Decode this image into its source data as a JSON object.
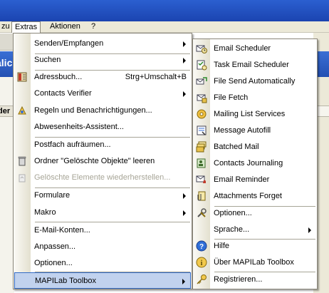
{
  "menubar": {
    "items": [
      {
        "label": "zu",
        "active": false
      },
      {
        "label": "Extras",
        "active": true
      },
      {
        "label": "Aktionen",
        "active": false
      },
      {
        "label": "?",
        "active": false
      }
    ]
  },
  "background": {
    "banner_text": "alic",
    "row_label": "der"
  },
  "extras_menu": {
    "items": [
      {
        "label": "Senden/Empfangen",
        "submenu": true,
        "icon": "none"
      },
      {
        "label": "Suchen",
        "submenu": true,
        "icon": "none"
      },
      {
        "label": "Adressbuch...",
        "shortcut": "Strg+Umschalt+B",
        "icon": "address-book-icon"
      },
      {
        "label": "Contacts Verifier",
        "submenu": true,
        "icon": "none"
      },
      {
        "label": "Regeln und Benachrichtigungen...",
        "icon": "rules-icon"
      },
      {
        "label": "Abwesenheits-Assistent...",
        "icon": "none"
      },
      {
        "label": "Postfach aufräumen...",
        "icon": "none"
      },
      {
        "label": "Ordner \"Gelöschte Objekte\" leeren",
        "icon": "trash-icon"
      },
      {
        "label": "Gelöschte Elemente wiederherstellen...",
        "disabled": true,
        "icon": "recover-icon"
      },
      {
        "label": "Formulare",
        "submenu": true,
        "icon": "none"
      },
      {
        "label": "Makro",
        "submenu": true,
        "icon": "none"
      },
      {
        "label": "E-Mail-Konten...",
        "icon": "none"
      },
      {
        "label": "Anpassen...",
        "icon": "none"
      },
      {
        "label": "Optionen...",
        "icon": "none"
      },
      {
        "label": "MAPILab Toolbox",
        "submenu": true,
        "highlighted": true,
        "icon": "none"
      }
    ]
  },
  "toolbox_menu": {
    "items": [
      {
        "label": "Email Scheduler",
        "icon": "email-scheduler-icon"
      },
      {
        "label": "Task Email Scheduler",
        "icon": "task-email-scheduler-icon"
      },
      {
        "label": "File Send Automatically",
        "icon": "file-send-icon"
      },
      {
        "label": "File Fetch",
        "icon": "file-fetch-icon"
      },
      {
        "label": "Mailing List Services",
        "icon": "mailing-list-icon"
      },
      {
        "label": "Message Autofill",
        "icon": "message-autofill-icon"
      },
      {
        "label": "Batched Mail",
        "icon": "batched-mail-icon"
      },
      {
        "label": "Contacts Journaling",
        "icon": "contacts-journaling-icon"
      },
      {
        "label": "Email Reminder",
        "icon": "email-reminder-icon"
      },
      {
        "label": "Attachments Forget",
        "icon": "attachments-forget-icon"
      },
      {
        "label": "Optionen...",
        "icon": "tools-icon"
      },
      {
        "label": "Sprache...",
        "submenu": true,
        "icon": "none"
      },
      {
        "label": "Hilfe",
        "icon": "help-icon"
      },
      {
        "label": "Über MAPILab Toolbox",
        "icon": "info-icon"
      },
      {
        "label": "Registrieren...",
        "icon": "key-icon"
      }
    ]
  },
  "colors": {
    "highlight_bg": "#c1d2ee",
    "highlight_border": "#316ac5",
    "menubar_bg": "#ece9d8",
    "title_blue": "#2b5fd0"
  }
}
